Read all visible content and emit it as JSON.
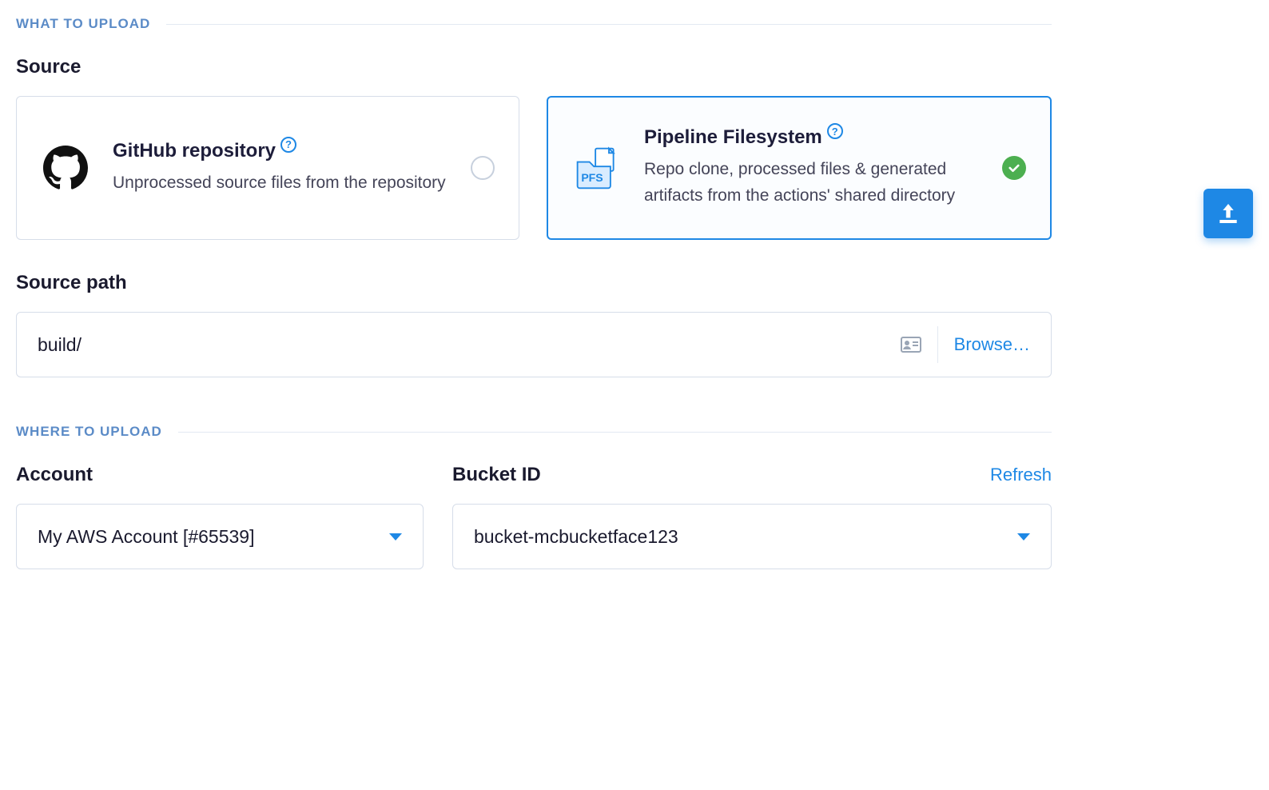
{
  "sections": {
    "what_to_upload": "WHAT TO UPLOAD",
    "where_to_upload": "WHERE TO UPLOAD"
  },
  "source": {
    "label": "Source",
    "options": {
      "github": {
        "title": "GitHub repository",
        "desc": "Unprocessed source files from the repository",
        "help": "?",
        "selected": false
      },
      "pfs": {
        "title": "Pipeline Filesystem",
        "desc": "Repo clone, processed files & generated artifacts from the actions' shared directory",
        "badge_text": "PFS",
        "help": "?",
        "selected": true
      }
    }
  },
  "source_path": {
    "label": "Source path",
    "value": "build/",
    "browse_label": "Browse…"
  },
  "account": {
    "label": "Account",
    "value": "My AWS Account [#65539]"
  },
  "bucket": {
    "label": "Bucket ID",
    "value": "bucket-mcbucketface123",
    "refresh_label": "Refresh"
  }
}
